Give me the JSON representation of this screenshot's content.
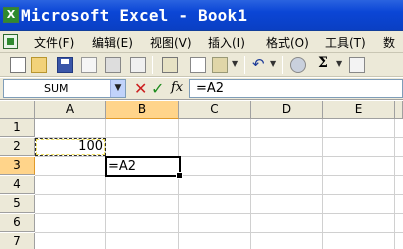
{
  "window": {
    "title": "Microsoft Excel - Book1"
  },
  "menu": {
    "items": [
      "文件(F)",
      "编辑(E)",
      "视图(V)",
      "插入(I)",
      "格式(O)",
      "工具(T)",
      "数"
    ]
  },
  "toolbar": {
    "icons": [
      "new-icon",
      "open-icon",
      "save-icon",
      "permission-icon",
      "print-icon",
      "print-preview-icon",
      "research-icon",
      "copy-icon",
      "paste-icon",
      "undo-icon",
      "hyperlink-icon",
      "autosum-icon",
      "sort-icon"
    ],
    "autosum_label": "Σ",
    "undo_label": "↶"
  },
  "formula_bar": {
    "name_box": "SUM",
    "cancel_label": "✕",
    "enter_label": "✓",
    "insert_function_label": "fx",
    "formula": "=A2"
  },
  "sheet": {
    "columns": [
      "A",
      "B",
      "C",
      "D",
      "E"
    ],
    "rows": [
      "1",
      "2",
      "3",
      "4",
      "5",
      "6",
      "7"
    ],
    "active_column": "B",
    "active_row": "3",
    "cells": {
      "A2": "100",
      "B3": "=A2"
    },
    "colors": {
      "header_bg": "#ece9d8",
      "active_header": "#ffd48a",
      "title_bar": "#0b46d6"
    }
  }
}
